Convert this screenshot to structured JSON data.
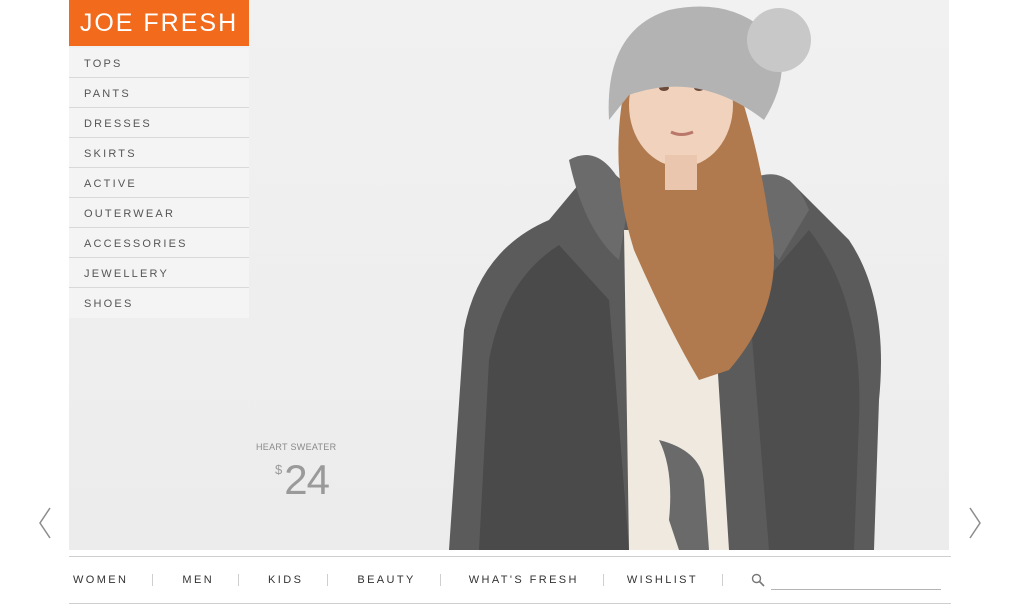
{
  "brand": {
    "logo_text": "JOE FRESH",
    "accent_color": "#f26a1b"
  },
  "categories": [
    {
      "label": "TOPS"
    },
    {
      "label": "PANTS"
    },
    {
      "label": "DRESSES"
    },
    {
      "label": "SKIRTS"
    },
    {
      "label": "ACTIVE"
    },
    {
      "label": "OUTERWEAR"
    },
    {
      "label": "ACCESSORIES"
    },
    {
      "label": "JEWELLERY"
    },
    {
      "label": "SHOES"
    }
  ],
  "feature": {
    "product_name": "HEART SWEATER",
    "currency": "$",
    "price": "24",
    "image_icon": "model-photo"
  },
  "carousel": {
    "prev_icon": "chevron-left-icon",
    "next_icon": "chevron-right-icon"
  },
  "bottom_nav": {
    "items": [
      {
        "label": "WOMEN"
      },
      {
        "label": "MEN"
      },
      {
        "label": "KIDS"
      },
      {
        "label": "BEAUTY"
      },
      {
        "label": "WHAT'S FRESH"
      },
      {
        "label": "WISHLIST"
      }
    ],
    "search_icon": "search-icon",
    "search_placeholder": ""
  }
}
